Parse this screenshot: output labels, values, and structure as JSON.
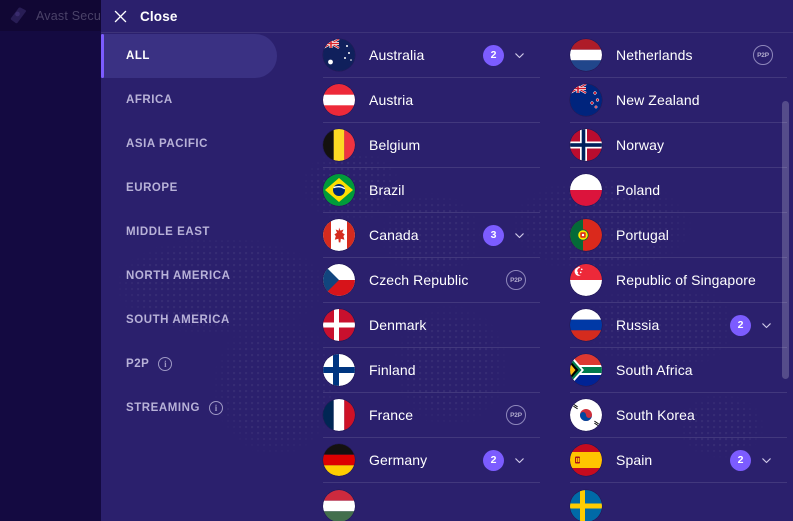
{
  "host": {
    "title": "Avast Secur",
    "logo_icon": "avast-logo-icon"
  },
  "panel": {
    "header": {
      "close_label": "Close",
      "close_icon": "close-icon"
    },
    "colors": {
      "panel_bg": "#2b206d",
      "active_item_bg": "#3a3183",
      "accent": "#7c5cff",
      "host_bg": "#150b42",
      "text": "#ffffff",
      "muted_text": "#b8b2d8"
    },
    "sidebar": {
      "items": [
        {
          "label": "ALL",
          "active": true,
          "info": false
        },
        {
          "label": "AFRICA",
          "active": false,
          "info": false
        },
        {
          "label": "ASIA PACIFIC",
          "active": false,
          "info": false
        },
        {
          "label": "EUROPE",
          "active": false,
          "info": false
        },
        {
          "label": "MIDDLE EAST",
          "active": false,
          "info": false
        },
        {
          "label": "NORTH AMERICA",
          "active": false,
          "info": false
        },
        {
          "label": "SOUTH AMERICA",
          "active": false,
          "info": false
        },
        {
          "label": "P2P",
          "active": false,
          "info": true,
          "info_icon": "info-icon"
        },
        {
          "label": "STREAMING",
          "active": false,
          "info": true,
          "info_icon": "info-icon"
        }
      ]
    },
    "columns": [
      {
        "rows": [
          {
            "name": "Australia",
            "flag": "au",
            "badge": "2",
            "chevron": true,
            "p2p": false
          },
          {
            "name": "Austria",
            "flag": "at",
            "badge": null,
            "chevron": false,
            "p2p": false
          },
          {
            "name": "Belgium",
            "flag": "be",
            "badge": null,
            "chevron": false,
            "p2p": false
          },
          {
            "name": "Brazil",
            "flag": "br",
            "badge": null,
            "chevron": false,
            "p2p": false
          },
          {
            "name": "Canada",
            "flag": "ca",
            "badge": "3",
            "chevron": true,
            "p2p": false
          },
          {
            "name": "Czech Republic",
            "flag": "cz",
            "badge": null,
            "chevron": false,
            "p2p": true
          },
          {
            "name": "Denmark",
            "flag": "dk",
            "badge": null,
            "chevron": false,
            "p2p": false
          },
          {
            "name": "Finland",
            "flag": "fi",
            "badge": null,
            "chevron": false,
            "p2p": false
          },
          {
            "name": "France",
            "flag": "fr",
            "badge": null,
            "chevron": false,
            "p2p": true
          },
          {
            "name": "Germany",
            "flag": "de",
            "badge": "2",
            "chevron": true,
            "p2p": false
          },
          {
            "name": "",
            "flag": "hu",
            "badge": null,
            "chevron": false,
            "p2p": false
          }
        ]
      },
      {
        "rows": [
          {
            "name": "Netherlands",
            "flag": "nl",
            "badge": null,
            "chevron": false,
            "p2p": true
          },
          {
            "name": "New Zealand",
            "flag": "nz",
            "badge": null,
            "chevron": false,
            "p2p": false
          },
          {
            "name": "Norway",
            "flag": "no",
            "badge": null,
            "chevron": false,
            "p2p": false
          },
          {
            "name": "Poland",
            "flag": "pl",
            "badge": null,
            "chevron": false,
            "p2p": false
          },
          {
            "name": "Portugal",
            "flag": "pt",
            "badge": null,
            "chevron": false,
            "p2p": false
          },
          {
            "name": "Republic of Singapore",
            "flag": "sg",
            "badge": null,
            "chevron": false,
            "p2p": false
          },
          {
            "name": "Russia",
            "flag": "ru",
            "badge": "2",
            "chevron": true,
            "p2p": false
          },
          {
            "name": "South Africa",
            "flag": "za",
            "badge": null,
            "chevron": false,
            "p2p": false
          },
          {
            "name": "South Korea",
            "flag": "kr",
            "badge": null,
            "chevron": false,
            "p2p": false
          },
          {
            "name": "Spain",
            "flag": "es",
            "badge": "2",
            "chevron": true,
            "p2p": false
          },
          {
            "name": "",
            "flag": "se",
            "badge": null,
            "chevron": false,
            "p2p": false
          }
        ]
      }
    ],
    "p2p_badge_label": "P2P",
    "info_glyph": "i",
    "scrollbar": {
      "thumb_top_pct": 14,
      "thumb_height_pct": 57
    }
  }
}
